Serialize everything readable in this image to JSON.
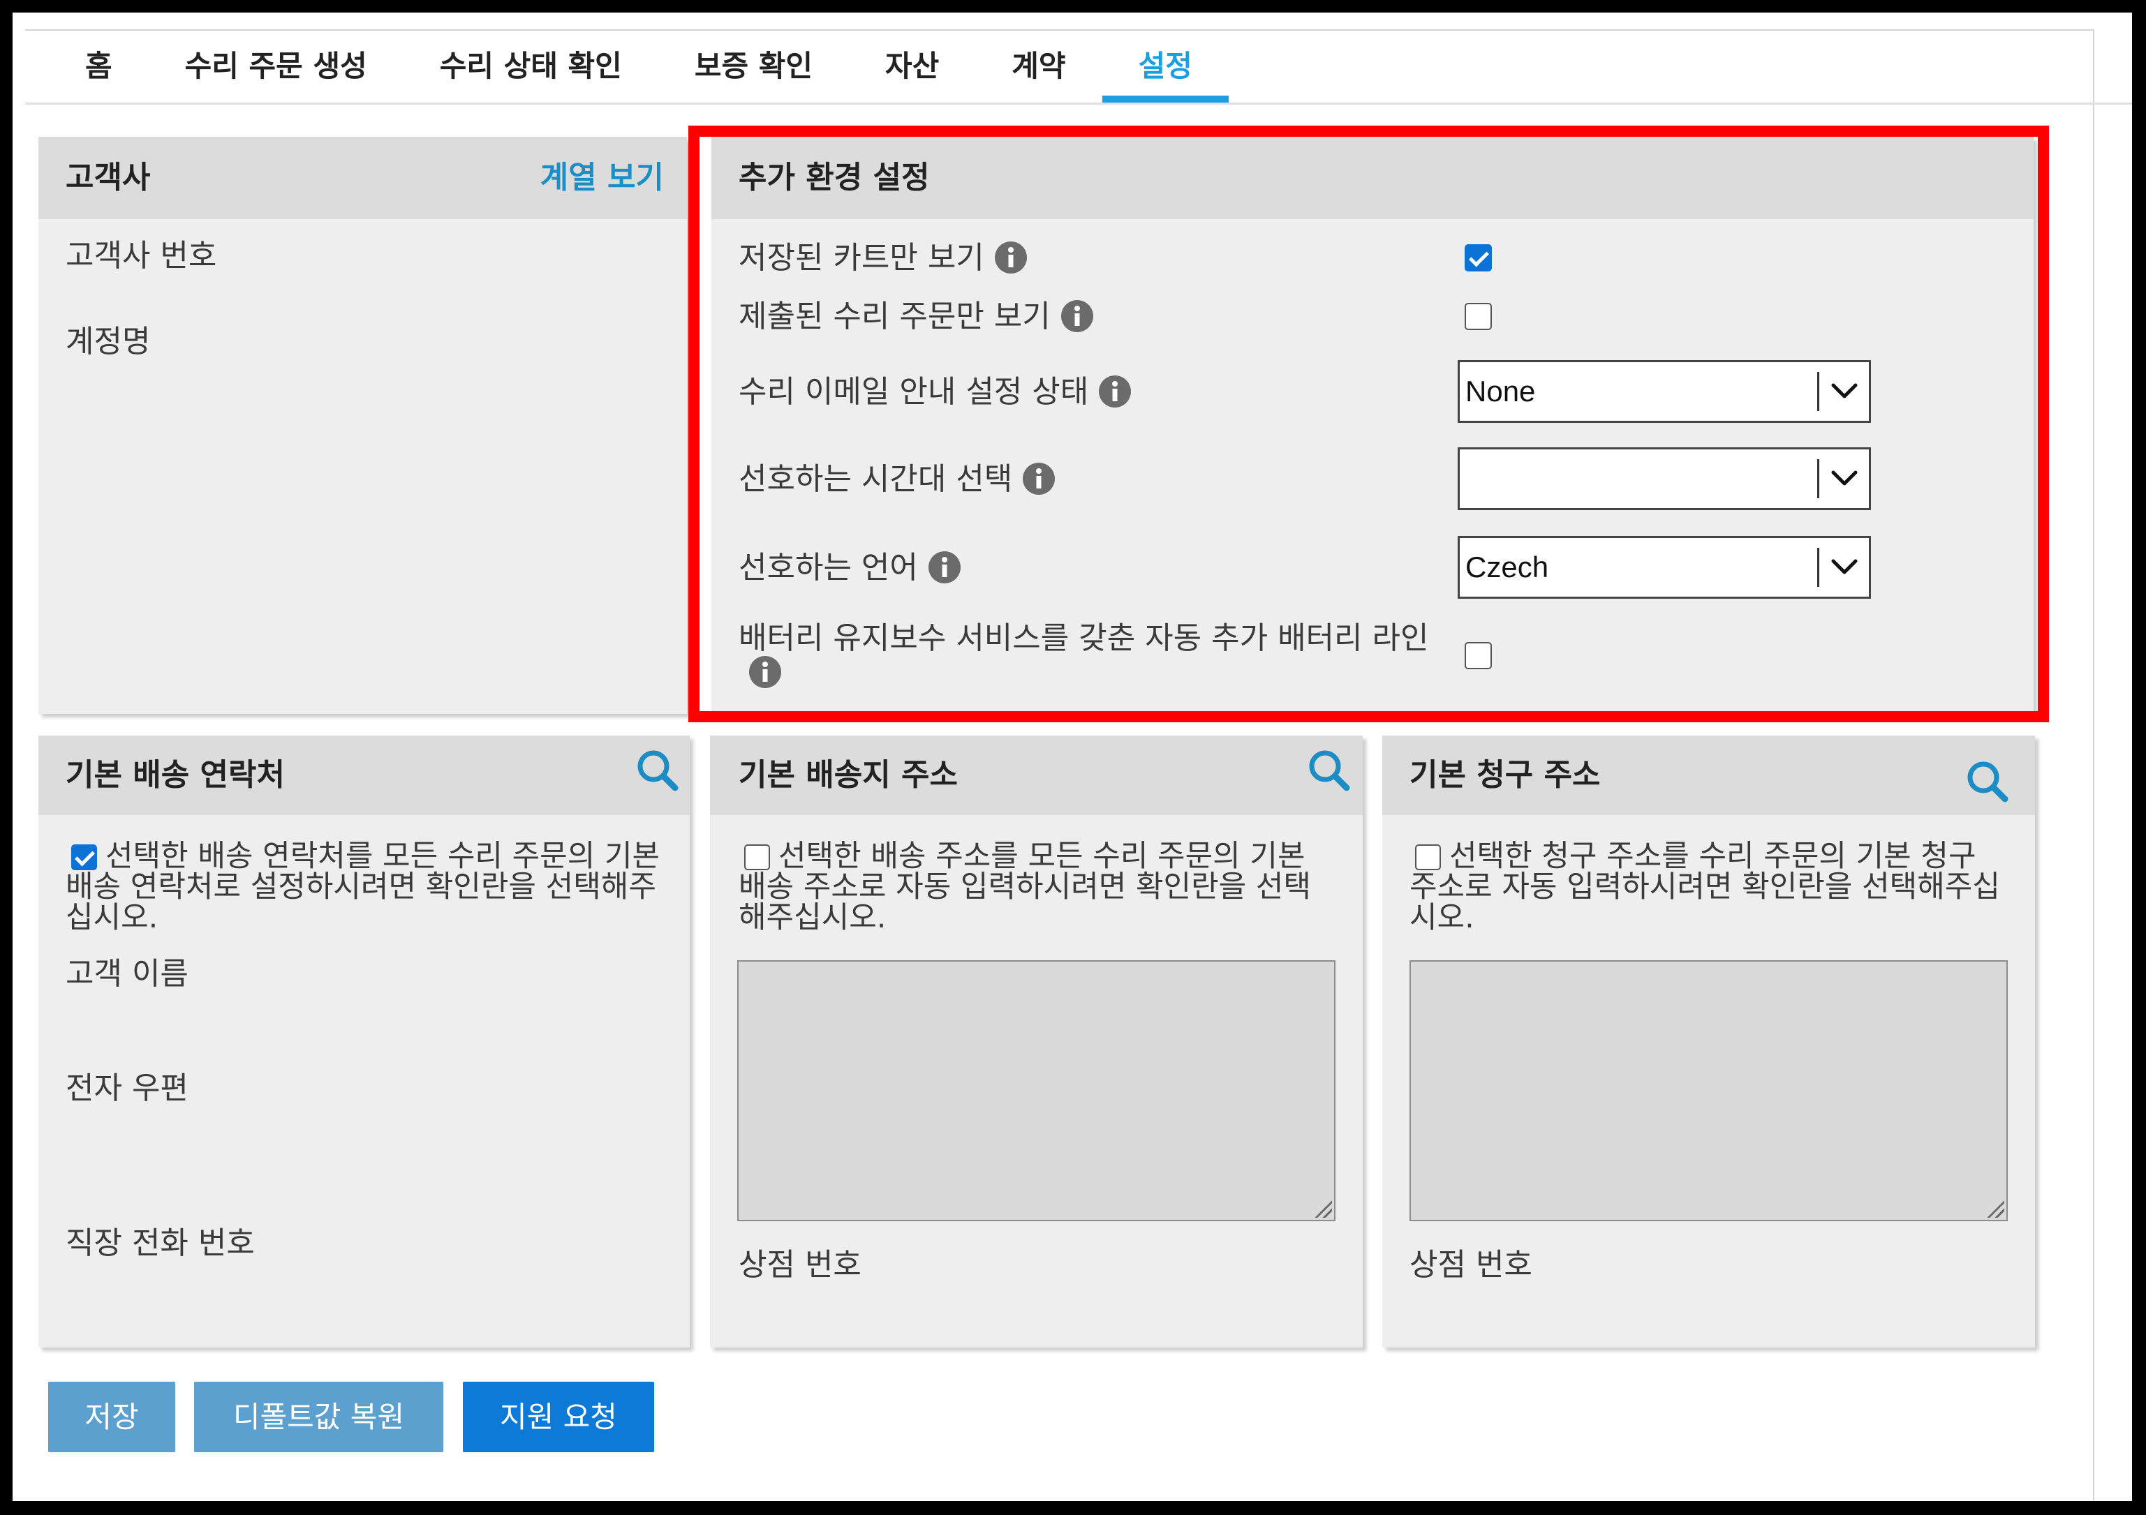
{
  "tabs": [
    {
      "label": "홈"
    },
    {
      "label": "수리 주문 생성"
    },
    {
      "label": "수리 상태 확인"
    },
    {
      "label": "보증 확인"
    },
    {
      "label": "자산"
    },
    {
      "label": "계약"
    },
    {
      "label": "설정",
      "active": true
    }
  ],
  "customer_panel": {
    "title": "고객사",
    "link_label": "계열 보기",
    "fields": [
      {
        "label": "고객사 번호"
      },
      {
        "label": "계정명"
      }
    ]
  },
  "preferences_panel": {
    "title": "추가 환경 설정",
    "saved_carts_only": {
      "label": "저장된 카트만 보기",
      "checked": true
    },
    "submitted_orders_only": {
      "label": "제출된 수리 주문만 보기",
      "checked": false
    },
    "email_notification": {
      "label": "수리 이메일 안내 설정 상태",
      "value": "None"
    },
    "timezone": {
      "label": "선호하는 시간대 선택",
      "value": ""
    },
    "language": {
      "label": "선호하는 언어",
      "value": "Czech"
    },
    "battery_line": {
      "label": "배터리 유지보수 서비스를 갖춘 자동 추가 배터리 라인",
      "checked": false
    }
  },
  "shipping_contact_panel": {
    "title": "기본 배송 연락처",
    "default_option": {
      "label": "선택한 배송 연락처를 모든 수리 주문의 기본 배송 연락처로 설정하시려면 확인란을 선택해주십시오.",
      "checked": true
    },
    "fields": [
      {
        "label": "고객 이름"
      },
      {
        "label": "전자 우편"
      },
      {
        "label": "직장 전화 번호"
      }
    ]
  },
  "shipping_address_panel": {
    "title": "기본 배송지 주소",
    "default_option": {
      "label": "선택한 배송 주소를 모든 수리 주문의 기본 배송 주소로 자동 입력하시려면 확인란을 선택해주십시오.",
      "checked": false
    },
    "address_value": "",
    "store_number_label": "상점 번호"
  },
  "billing_address_panel": {
    "title": "기본 청구 주소",
    "default_option": {
      "label": "선택한 청구 주소를 수리 주문의 기본 청구 주소로 자동 입력하시려면 확인란을 선택해주십시오.",
      "checked": false
    },
    "address_value": "",
    "store_number_label": "상점 번호"
  },
  "buttons": {
    "save": "저장",
    "restore_defaults": "디폴트값 복원",
    "request_support": "지원 요청"
  },
  "icons": {
    "info": "info-icon",
    "search": "search-icon",
    "dropdown": "chevron-down-icon",
    "checkbox_checked": "check-icon"
  },
  "colors": {
    "active_tab": "#1a9fe0",
    "link": "#1b8ec6",
    "annotation_border": "#ff0000",
    "checkbox_checked": "#0b73d8",
    "primary_button": "#0e7ad8",
    "secondary_button": "#5ba0cf",
    "panel_header": "#dcdcdc",
    "panel_body": "#eeeeee"
  }
}
